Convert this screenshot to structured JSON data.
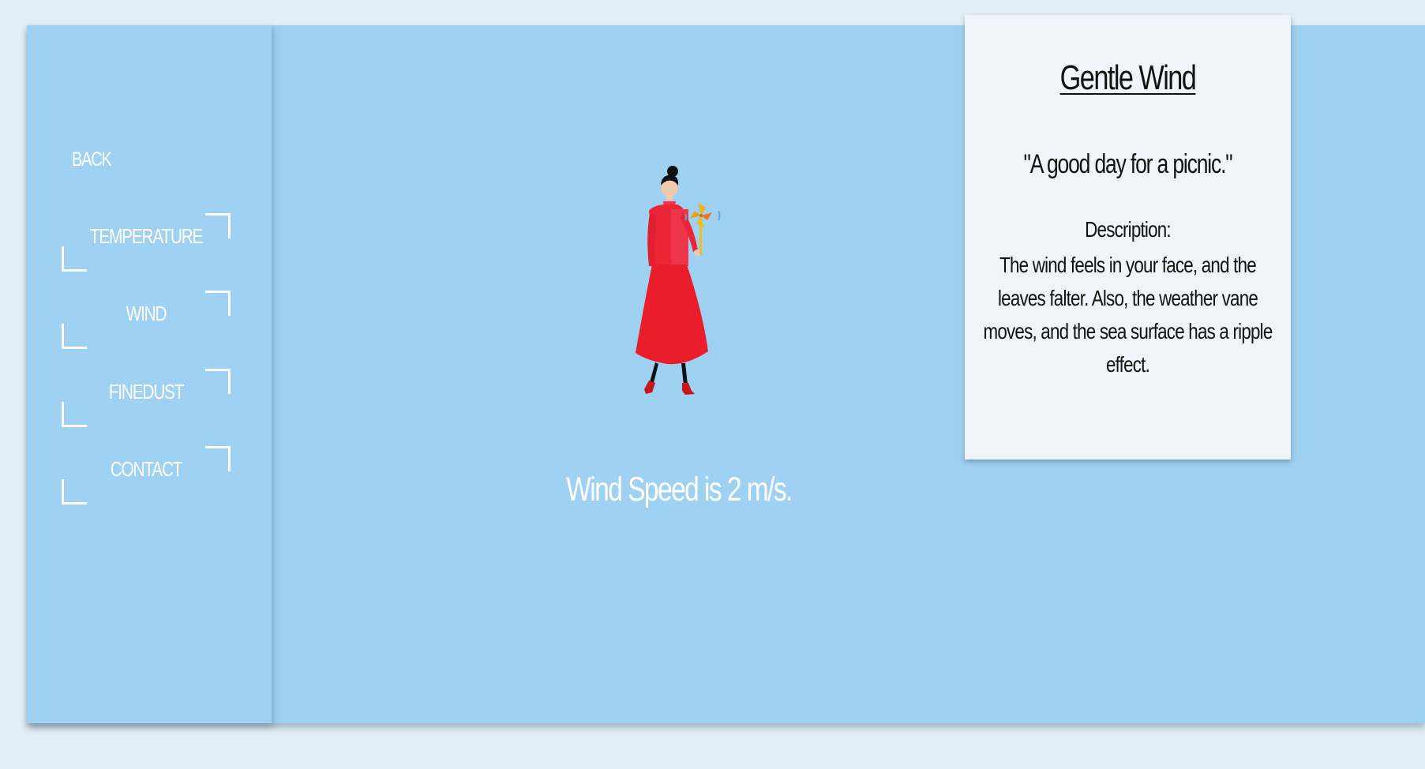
{
  "nav": {
    "back_label": "BACK",
    "items": [
      {
        "label": "TEMPERATURE"
      },
      {
        "label": "WIND"
      },
      {
        "label": "FINEDUST"
      },
      {
        "label": "CONTACT"
      }
    ]
  },
  "main": {
    "wind_speed_text": "Wind Speed is 2 m/s."
  },
  "info_card": {
    "title": "Gentle Wind",
    "quote": "\"A good day for a picnic.\"",
    "description_label": "Description:",
    "description": "The wind feels in your face, and the leaves falter. Also, the weather vane moves, and the sea surface has a ripple effect."
  },
  "colors": {
    "background": "#e3eef6",
    "panel": "#9fd1f3",
    "card": "#eef4f9",
    "dress": "#e8202a",
    "text_dark": "#111111",
    "text_light": "#ffffff"
  },
  "illustration": {
    "subject": "woman-in-red-dress-holding-pinwheel"
  }
}
